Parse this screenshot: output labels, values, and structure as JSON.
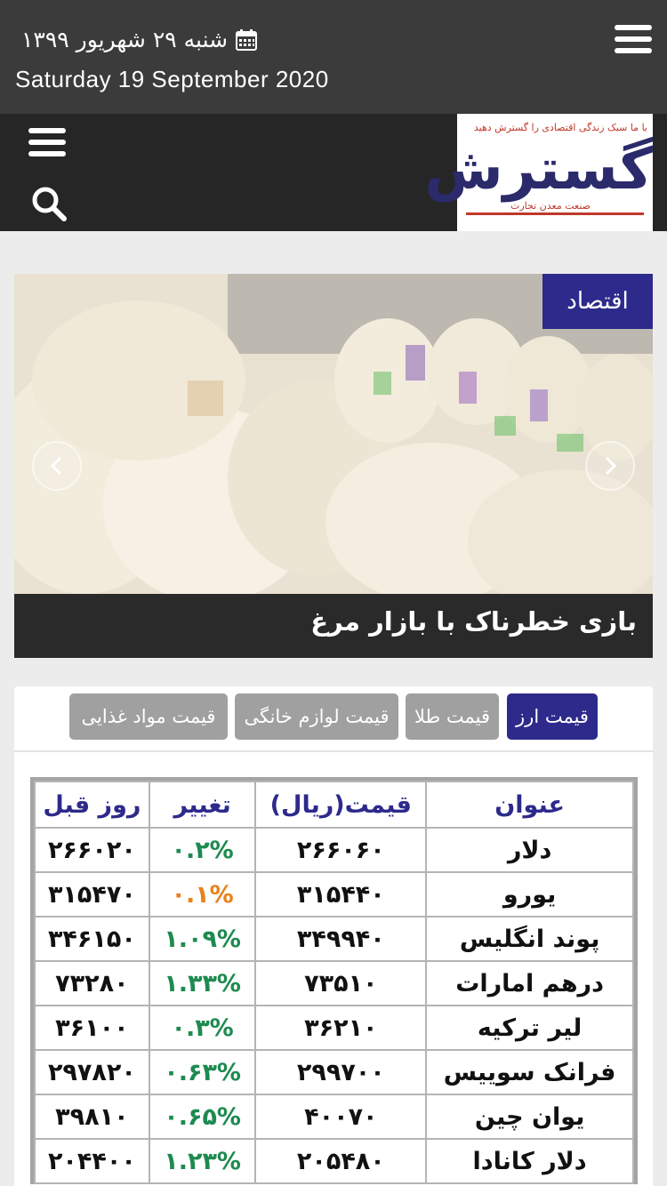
{
  "topbar": {
    "date_persian": "شنبه ۲۹ شهریور ۱۳۹۹",
    "date_english": "Saturday 19 September 2020"
  },
  "header": {
    "logo_text": "گسترش",
    "logo_tagline": "با ما سبک زندگی اقتصادی را گسترش دهید",
    "logo_subtitle": "صنعت معدن تجارت"
  },
  "slider": {
    "category": "اقتصاد",
    "caption": "بازی خطرناک با بازار مرغ"
  },
  "tabs": [
    {
      "label": "قیمت ارز",
      "active": true
    },
    {
      "label": "قیمت طلا",
      "active": false
    },
    {
      "label": "قیمت لوازم خانگی",
      "active": false
    },
    {
      "label": "قیمت مواد غذایی",
      "active": false
    }
  ],
  "table": {
    "headers": {
      "name": "عنوان",
      "price": "قیمت(ریال)",
      "change": "تغییر",
      "previous": "روز قبل"
    },
    "rows": [
      {
        "name": "دلار",
        "price": "۲۶۶۰۶۰",
        "change": "۰.۲%",
        "previous": "۲۶۶۰۲۰"
      },
      {
        "name": "یورو",
        "price": "۳۱۵۴۴۰",
        "change": "۰.۱%",
        "previous": "۳۱۵۴۷۰"
      },
      {
        "name": "پوند انگلیس",
        "price": "۳۴۹۹۴۰",
        "change": "۱.۰۹%",
        "previous": "۳۴۶۱۵۰"
      },
      {
        "name": "درهم امارات",
        "price": "۷۳۵۱۰",
        "change": "۱.۳۳%",
        "previous": "۷۳۲۸۰"
      },
      {
        "name": "لیر ترکیه",
        "price": "۳۶۲۱۰",
        "change": "۰.۳%",
        "previous": "۳۶۱۰۰"
      },
      {
        "name": "فرانک سوییس",
        "price": "۲۹۹۷۰۰",
        "change": "۰.۶۳%",
        "previous": "۲۹۷۸۲۰"
      },
      {
        "name": "یوان چین",
        "price": "۴۰۰۷۰",
        "change": "۰.۶۵%",
        "previous": "۳۹۸۱۰"
      },
      {
        "name": "دلار کانادا",
        "price": "۲۰۵۴۸۰",
        "change": "۱.۲۳%",
        "previous": "۲۰۴۴۰۰"
      }
    ]
  },
  "colors": {
    "accent": "#2d2a8c",
    "change_up": "#1e8a50",
    "change_small": "#e8821a"
  }
}
